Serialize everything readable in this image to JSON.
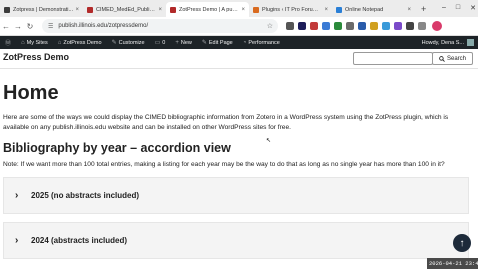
{
  "browser": {
    "tabs": [
      {
        "title": "Zotpress | Demonstrati...",
        "favicon_color": "#3b3b3b",
        "active": false
      },
      {
        "title": "CIMED_MedEd_Publicat...",
        "favicon_color": "#b22a2a",
        "active": false
      },
      {
        "title": "ZotPress Demo | A publi...",
        "favicon_color": "#b22a2a",
        "active": true
      },
      {
        "title": "Plugins ‹ IT Pro Forum ...",
        "favicon_color": "#d96a1f",
        "active": false
      },
      {
        "title": "Online Notepad",
        "favicon_color": "#2a7fd6",
        "active": false
      }
    ],
    "new_tab": "+",
    "close_glyph": "×",
    "window_controls": {
      "minimize": "–",
      "maximize": "□",
      "close": "✕"
    },
    "back": "←",
    "forward": "→",
    "reload": "↻",
    "url": "publish.illinois.edu/zotpressdemo/",
    "site_info": "☰",
    "star": "☆"
  },
  "wp_admin_bar": {
    "items": [
      {
        "icon": "wordpress-icon",
        "glyph": "Ⓦ",
        "label": ""
      },
      {
        "icon": "my-sites-icon",
        "glyph": "⌂",
        "label": "My Sites"
      },
      {
        "icon": "home-icon",
        "glyph": "⌂",
        "label": "ZotPress Demo"
      },
      {
        "icon": "customize-icon",
        "glyph": "✎",
        "label": "Customize"
      },
      {
        "icon": "comments-icon",
        "glyph": "▭",
        "label": "0"
      },
      {
        "icon": "plus-icon",
        "glyph": "+",
        "label": "New"
      },
      {
        "icon": "edit-icon",
        "glyph": "✎",
        "label": "Edit Page"
      },
      {
        "icon": "performance-icon",
        "glyph": "◔",
        "label": "Performance"
      }
    ],
    "greeting": "Howdy, Dena S..."
  },
  "site": {
    "title": "ZotPress Demo",
    "search_button": "Search",
    "search_value": ""
  },
  "content": {
    "title": "Home",
    "intro": "Here are some of the ways we could display the CIMED bibliographic information from Zotero in a WordPress system using the ZotPress plugin, which is available on any publish.illinois.edu website and can be installed on other WordPress sites for free.",
    "heading": "Bibliography by year – accordion view",
    "note": "Note: If we want more than 100 total entries, making a listing for each year may be the way to do that as long as no single year has more than 100 in it?",
    "accordions": [
      {
        "label": "2025 (no abstracts included)",
        "chevron": "›"
      },
      {
        "label": "2024 (abstracts included)",
        "chevron": "›"
      }
    ]
  },
  "scroll_top": "↑",
  "timestamp": "2026-04-21 23:44"
}
